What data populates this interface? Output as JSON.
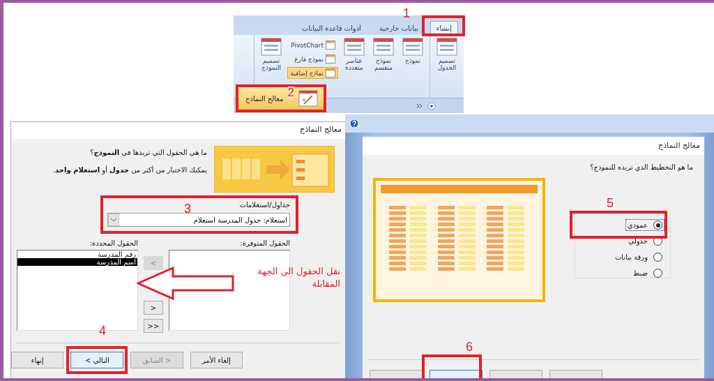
{
  "ribbon": {
    "step": "1",
    "tabs": [
      {
        "label": "إنشاء",
        "selected": true
      },
      {
        "label": "بيانات خارجية",
        "selected": false
      },
      {
        "label": "أدوات قاعدة البيانات",
        "selected": false
      }
    ],
    "table_design": "تصميم الجدول",
    "large_buttons": [
      {
        "label": "نموذج"
      },
      {
        "label": "نموذج منقسم"
      },
      {
        "label": "عناصر متعددة"
      }
    ],
    "small_buttons": [
      {
        "label": "PivotChart",
        "highlighted": false
      },
      {
        "label": "نموذج فارغ",
        "highlighted": false
      },
      {
        "label": "نماذج إضافية",
        "highlighted": true
      }
    ],
    "form_design": "تصميم النموذج",
    "menu_item": {
      "label": "معالج النماذج",
      "step": "2"
    }
  },
  "fields_dialog": {
    "title": "معالج النماذج",
    "question": "ما هي الحقول التي تريدها في **النموذج**؟",
    "hint": "يمكنك الاختيار من أكثر من **جدول** أو **استعلام واحد**.",
    "source_label": "جداول/استعلامات",
    "source_step": "3",
    "source_value": "استعلام: جدول المدرسة استعلام",
    "available_label": "الحقول المتوفرة:",
    "selected_label": "الحقول المحددة:",
    "selected_fields": [
      {
        "label": "رقم المدرسة",
        "selected": false
      },
      {
        "label": "اسم المدرسة",
        "selected": true
      }
    ],
    "move_buttons": [
      {
        "label": "<",
        "disabled": true
      },
      {
        "label": ">",
        "disabled": false
      },
      {
        "label": ">>",
        "disabled": false
      }
    ],
    "annotation": "نقل الحقول الى الجهة المقابلة",
    "next_step": "4",
    "buttons": [
      {
        "label": "إلغاء الأمر",
        "disabled": false,
        "kind": "cancel"
      },
      {
        "label": "< السابق",
        "disabled": true,
        "kind": "back"
      },
      {
        "label": "التالي >",
        "disabled": false,
        "kind": "next"
      },
      {
        "label": "إنهاء",
        "disabled": false,
        "kind": "finish"
      }
    ]
  },
  "layout_dialog": {
    "title": "معالج النماذج",
    "question": "ما هو التخطيط الذي تريده للنموذج؟",
    "options_step": "5",
    "options": [
      {
        "label": "عمودي",
        "selected": true
      },
      {
        "label": "جدولي",
        "selected": false
      },
      {
        "label": "ورقة بيانات",
        "selected": false
      },
      {
        "label": "ضبط",
        "selected": false
      }
    ],
    "next_step": "6"
  }
}
